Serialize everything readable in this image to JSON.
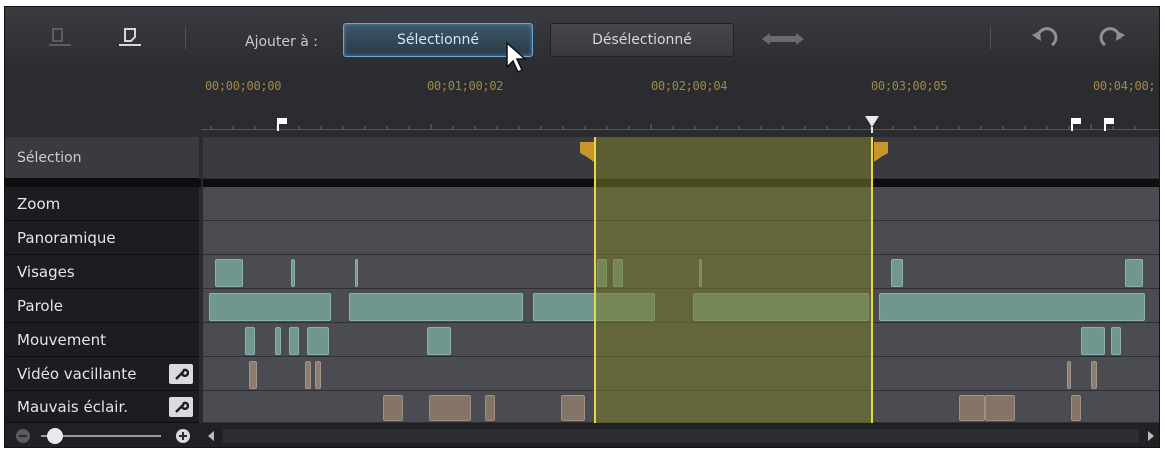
{
  "toolbar": {
    "add_to_label": "Ajouter à :",
    "selected_button": "Sélectionné",
    "deselected_button": "Désélectionné"
  },
  "ruler": {
    "timecodes": [
      "00;00;00;00",
      "00;01;00;02",
      "00;02;00;04",
      "00;03;00;05",
      "00;04;00;"
    ]
  },
  "tracks": {
    "selection": "Sélection",
    "zoom": "Zoom",
    "pan": "Panoramique",
    "faces": "Visages",
    "speech": "Parole",
    "motion": "Mouvement",
    "shaky": "Vidéo vacillante",
    "poor_light": "Mauvais éclair."
  },
  "colors": {
    "accent_blue": "#6aa6d0",
    "selection_region": "#7a7a28",
    "selection_edge": "#e3d94a",
    "timecode": "#a08a3c",
    "speech_segment": "#6f9790"
  }
}
